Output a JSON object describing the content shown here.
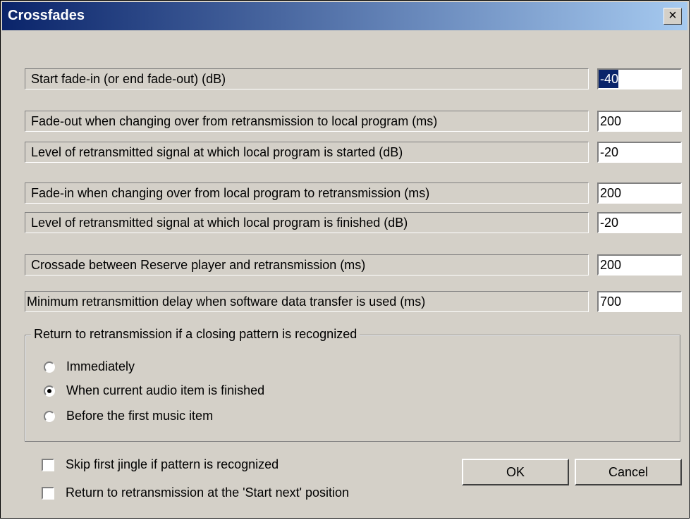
{
  "window": {
    "title": "Crossfades",
    "close_glyph": "×",
    "close_icon": "close-icon"
  },
  "fields": [
    {
      "label": "Start fade-in (or end fade-out) (dB)",
      "value": "-40",
      "selected": true
    },
    {
      "label": "Fade-out when changing over from retransmission to local program (ms)",
      "value": "200"
    },
    {
      "label": "Level of retransmitted signal at which local program is started (dB)",
      "value": "-20"
    },
    {
      "label": "Fade-in when changing over from local program to retransmission (ms)",
      "value": "200"
    },
    {
      "label": "Level of retransmitted signal at which local program is finished (dB)",
      "value": "-20"
    },
    {
      "label": "Crossade between Reserve player and retransmission (ms)",
      "value": "200"
    },
    {
      "label": "Minimum retransmittion delay when software data transfer is used (ms)",
      "value": "700"
    }
  ],
  "return_group": {
    "title": "Return to retransmission if a closing pattern is recognized",
    "options": [
      {
        "label": "Immediately",
        "checked": false
      },
      {
        "label": "When current audio item is finished",
        "checked": true
      },
      {
        "label": "Before the first music item",
        "checked": false
      }
    ]
  },
  "checkboxes": [
    {
      "label": "Skip first jingle if pattern is recognized",
      "checked": false
    },
    {
      "label": "Return to retransmission at the 'Start next' position",
      "checked": false
    }
  ],
  "buttons": {
    "ok": "OK",
    "cancel": "Cancel"
  },
  "colors": {
    "dialog_bg": "#d4d0c8",
    "title_start": "#0a246a",
    "title_end": "#a6caf0",
    "selection": "#0a246a"
  }
}
